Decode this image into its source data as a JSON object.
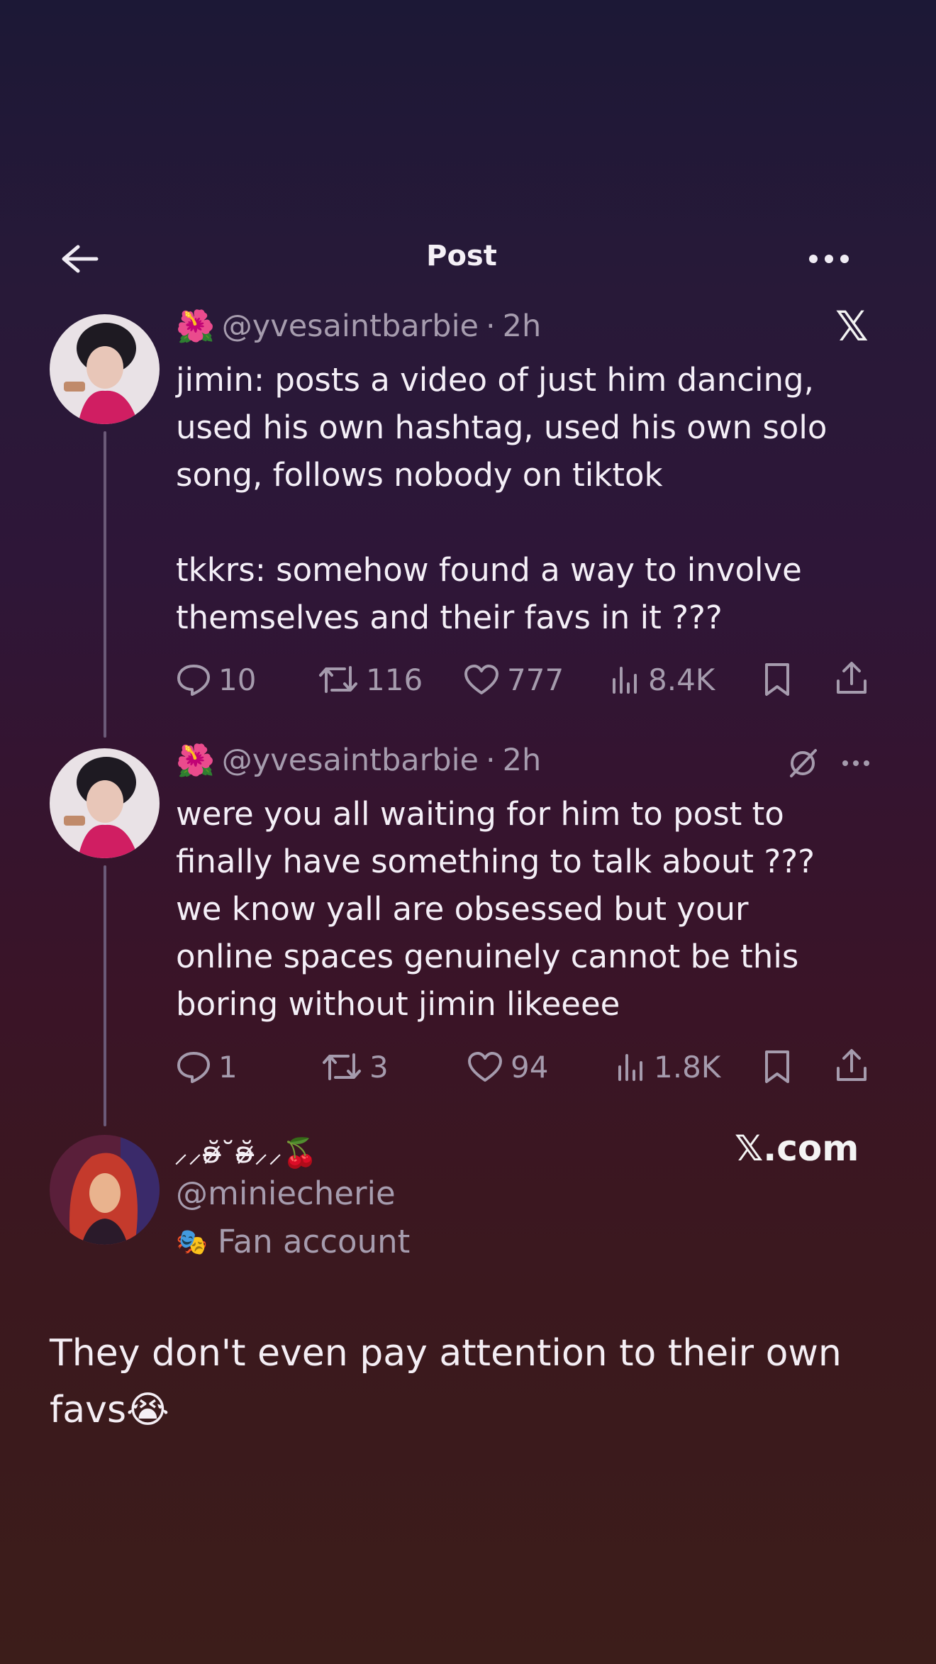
{
  "header": {
    "title": "Post"
  },
  "tweet1": {
    "emoji": "🌺",
    "handle": "@yvesaintbarbie",
    "sep": "·",
    "time": "2h",
    "text": "jimin: posts a video of just him dancing,\nused his own hashtag, used his own solo\nsong, follows nobody on tiktok\n\ntkkrs: somehow found a way to involve\nthemselves and their favs in it ???",
    "replies": "10",
    "reposts": "116",
    "likes": "777",
    "views": "8.4K"
  },
  "tweet2": {
    "emoji": "🌺",
    "handle": "@yvesaintbarbie",
    "sep": "·",
    "time": "2h",
    "text": "were you all waiting for him to post to\nfinally have something to talk about ???\nwe know yall are obsessed but your\nonline spaces genuinely cannot be this\nboring without jimin likeeee",
    "replies": "1",
    "reposts": "3",
    "likes": "94",
    "views": "1.8K"
  },
  "quote": {
    "display_name": "⸝⸝ʚ̴̶̷̆˘ʚ̴̶̷̆⸝⸝🍒",
    "handle": "@miniecherie",
    "label_icon": "🎭",
    "label": "Fan account",
    "site": "𝕏.com",
    "text": "They don't even pay attention to their own favs😭"
  },
  "icons": {
    "x_logo": "𝕏",
    "back": "arrow-left-icon",
    "more": "more-icon"
  },
  "colors": {
    "text": "#f4eff7",
    "muted": "#a69cae",
    "thread_line": "#6b5a78"
  }
}
